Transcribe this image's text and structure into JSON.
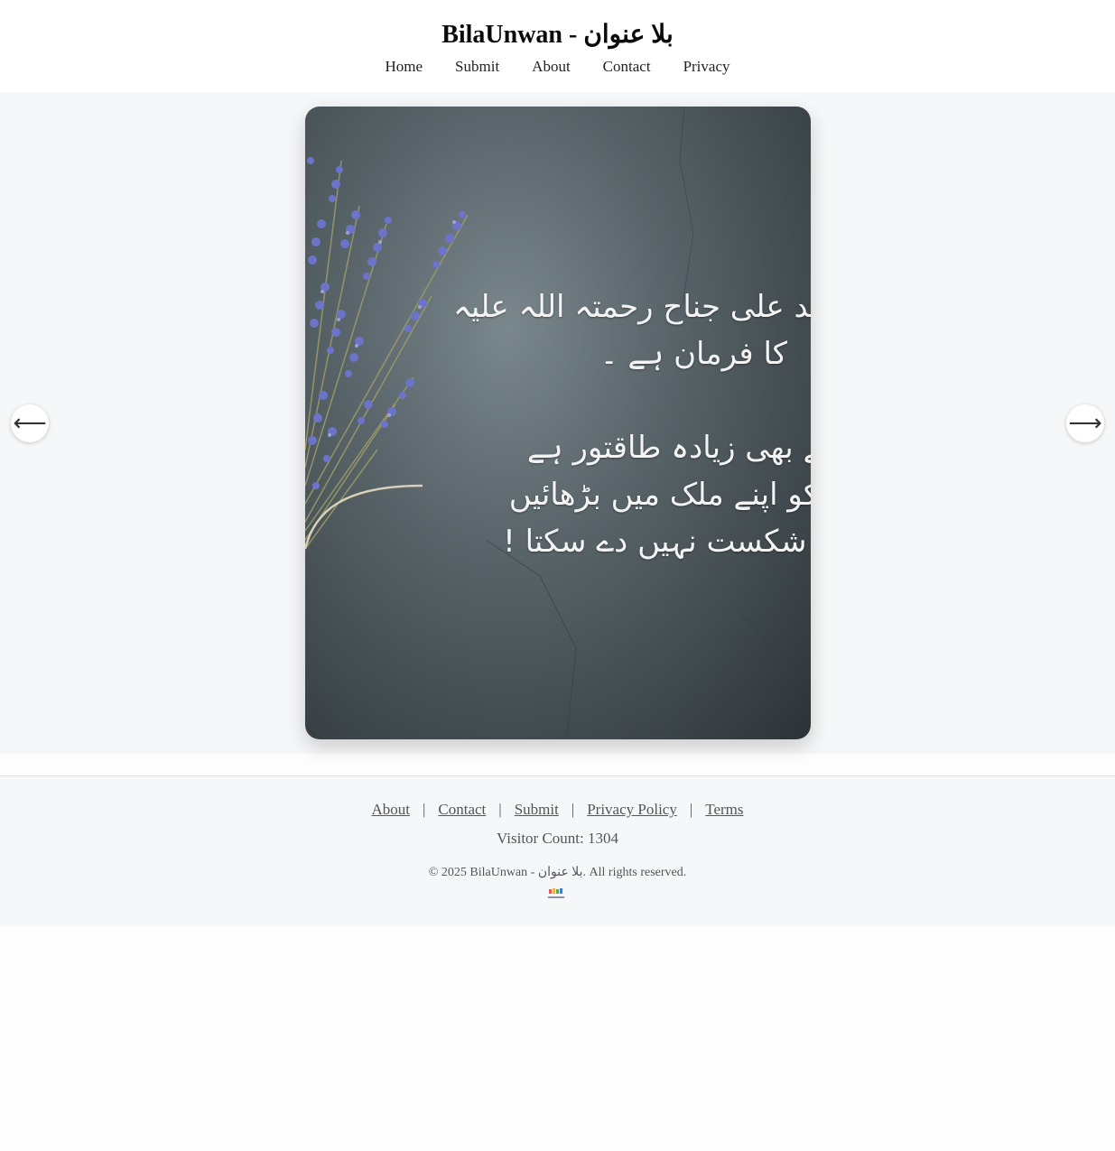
{
  "header": {
    "site_title": "BilaUnwan - بلا عنوان",
    "nav": [
      "Home",
      "Submit",
      "About",
      "Contact",
      "Privacy"
    ]
  },
  "carousel": {
    "slide_lines": [
      "حمد علی جناح رحمتہ اللہ علیہ",
      "کا فرمان ہے ۔",
      "سے بھی زیادہ طاقتور ہے",
      "م کو اپنے ملک میں بڑھائیں",
      "کو شکست نہیں دے سکتا !"
    ],
    "prev_symbol": "⟵",
    "next_symbol": "⟶"
  },
  "footer": {
    "links": [
      "About",
      "Contact",
      "Submit",
      "Privacy Policy",
      "Terms"
    ],
    "separator": "|",
    "visitor_count_label": "Visitor Count: 1304",
    "copyright": "© 2025 BilaUnwan - بلا عنوان. All rights reserved."
  },
  "colors": {
    "page_background": "#fdfdfd",
    "band_background": "#f6f7f8",
    "slide_text": "#f4f4f4",
    "lavender": "#6b74c9"
  }
}
